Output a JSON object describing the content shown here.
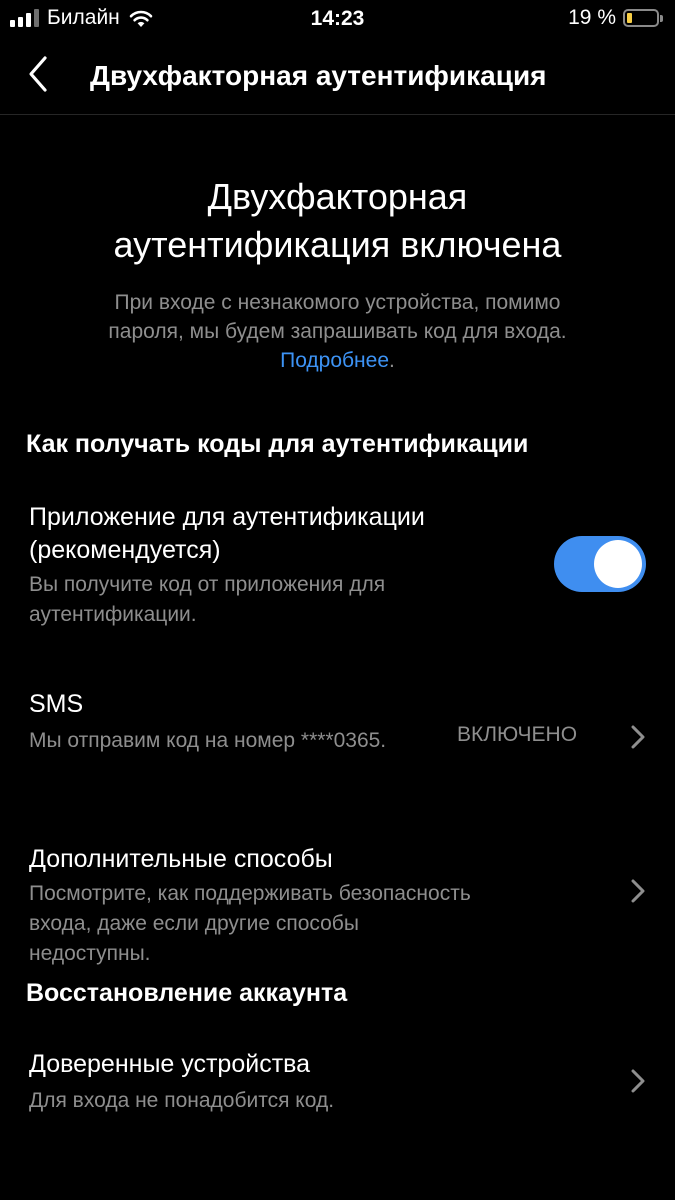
{
  "status_bar": {
    "carrier": "Билайн",
    "time": "14:23",
    "battery_text": "19 %",
    "battery_level": 0.19,
    "battery_color": "#f7ce46",
    "signal_bars_active": 3,
    "signal_bars_total": 4,
    "wifi_icon": "wifi-icon"
  },
  "nav": {
    "title": "Двухфакторная аутентификация",
    "back_icon": "chevron-left-icon"
  },
  "hero": {
    "title_line1": "Двухфакторная",
    "title_line2": "аутентификация включена",
    "desc_line1": "При входе с незнакомого устройства, помимо",
    "desc_line2": "пароля, мы будем запрашивать код для входа.",
    "link_text": "Подробнее",
    "link_suffix": "."
  },
  "sections": {
    "codes_header": "Как получать коды для аутентификации",
    "recovery_header": "Восстановление аккаунта"
  },
  "auth_app": {
    "title_line1": "Приложение для аутентификации",
    "title_line2": "(рекомендуется)",
    "subtitle_line1": "Вы получите код от приложения для",
    "subtitle_line2": "аутентификации.",
    "enabled": true,
    "toggle_color": "#3f8ef0"
  },
  "sms": {
    "title": "SMS",
    "subtitle": "Мы отправим код на номер ****0365.",
    "status": "ВКЛЮЧЕНО"
  },
  "additional": {
    "title": "Дополнительные способы",
    "subtitle_line1": "Посмотрите, как поддерживать безопасность",
    "subtitle_line2": "входа, даже если другие способы",
    "subtitle_line3": "недоступны."
  },
  "trusted": {
    "title": "Доверенные устройства",
    "subtitle": "Для входа не понадобится код."
  },
  "colors": {
    "background": "#000000",
    "text": "#ffffff",
    "secondary_text": "#8e8e8e",
    "link": "#3d93f5"
  }
}
